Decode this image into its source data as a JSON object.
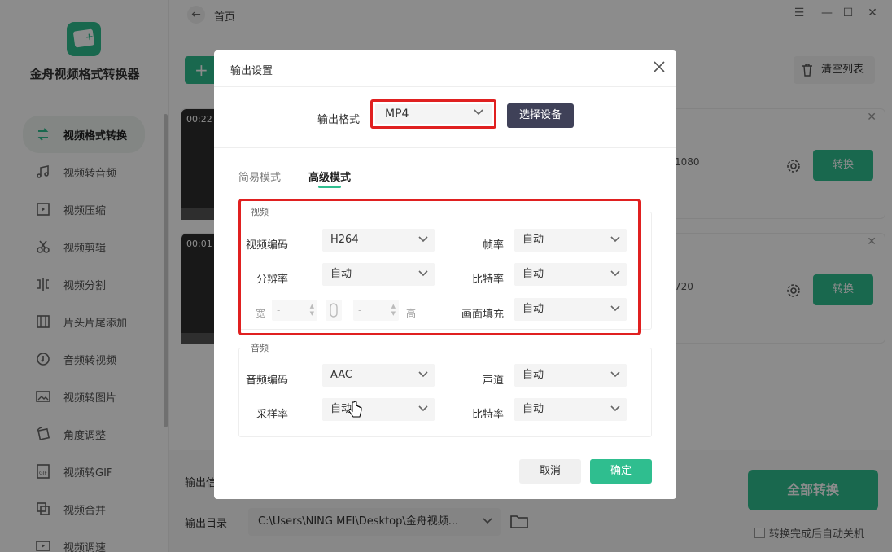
{
  "app": {
    "name": "金舟视频格式转换器"
  },
  "sidebar": {
    "items": [
      {
        "label": "视频格式转换",
        "icon": "convert-icon",
        "active": true
      },
      {
        "label": "视频转音频",
        "icon": "music-icon"
      },
      {
        "label": "视频压缩",
        "icon": "compress-icon"
      },
      {
        "label": "视频剪辑",
        "icon": "scissors-icon"
      },
      {
        "label": "视频分割",
        "icon": "split-icon"
      },
      {
        "label": "片头片尾添加",
        "icon": "film-icon"
      },
      {
        "label": "音频转视频",
        "icon": "audio-video-icon"
      },
      {
        "label": "视频转图片",
        "icon": "image-icon"
      },
      {
        "label": "角度调整",
        "icon": "rotate-icon"
      },
      {
        "label": "视频转GIF",
        "icon": "gif-icon"
      },
      {
        "label": "视频合并",
        "icon": "merge-icon"
      },
      {
        "label": "视频调速",
        "icon": "speed-icon"
      }
    ]
  },
  "header": {
    "breadcrumb": "首页"
  },
  "toolbar": {
    "add_label": "+",
    "clear_label": "清空列表"
  },
  "files": [
    {
      "time": "00:22",
      "resolution": "1080",
      "convert_label": "转换"
    },
    {
      "time": "00:01",
      "resolution": "720",
      "convert_label": "转换"
    }
  ],
  "bottom": {
    "output_label": "输出信",
    "dir_label": "输出目录",
    "dir_value": "C:\\Users\\NING MEI\\Desktop\\金舟视频...",
    "all_convert_label": "全部转换",
    "auto_shutdown_label": "转换完成后自动关机"
  },
  "dialog": {
    "title": "输出设置",
    "format_label": "输出格式",
    "format_value": "MP4",
    "device_button": "选择设备",
    "tabs": [
      {
        "label": "简易模式"
      },
      {
        "label": "高级模式",
        "active": true
      }
    ],
    "video": {
      "title": "视频",
      "codec_label": "视频编码",
      "codec_value": "H264",
      "fps_label": "帧率",
      "fps_value": "自动",
      "resolution_label": "分辨率",
      "resolution_value": "自动",
      "bitrate_label": "比特率",
      "bitrate_value": "自动",
      "width_label": "宽",
      "width_value": "-",
      "height_label": "高",
      "height_value": "-",
      "fill_label": "画面填充",
      "fill_value": "自动"
    },
    "audio": {
      "title": "音频",
      "codec_label": "音频编码",
      "codec_value": "AAC",
      "channel_label": "声道",
      "channel_value": "自动",
      "samplerate_label": "采样率",
      "samplerate_value": "自动",
      "bitrate_label": "比特率",
      "bitrate_value": "自动"
    },
    "cancel_label": "取消",
    "ok_label": "确定"
  },
  "colors": {
    "accent": "#2fbe8f",
    "highlight": "#e02020",
    "device_button": "#3f4158"
  }
}
